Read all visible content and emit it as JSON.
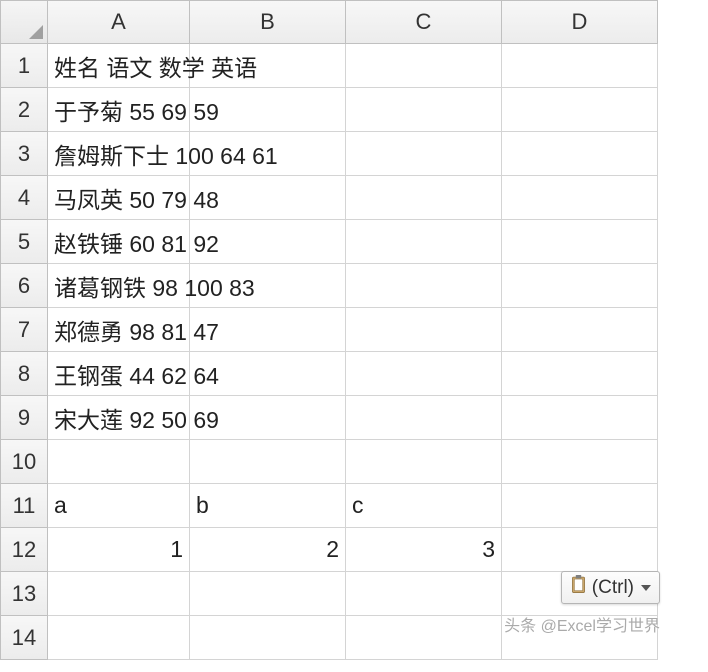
{
  "columns": [
    "A",
    "B",
    "C",
    "D"
  ],
  "row_count": 14,
  "cells": {
    "A1": "姓名 语文 数学 英语",
    "A2": "于予菊 55 69 59",
    "A3": "詹姆斯下士 100 64 61",
    "A4": "马凤英 50 79 48",
    "A5": "赵铁锤 60 81 92",
    "A6": "诸葛钢铁 98 100 83",
    "A7": "郑德勇 98 81 47",
    "A8": "王钢蛋 44 62 64",
    "A9": "宋大莲 92 50 69",
    "A11": "a",
    "B11": "b",
    "C11": "c",
    "A12": "1",
    "B12": "2",
    "C12": "3"
  },
  "numeric_cells": [
    "A12",
    "B12",
    "C12"
  ],
  "paste_button": {
    "label": "(Ctrl)"
  },
  "watermark": "头条 @Excel学习世界"
}
